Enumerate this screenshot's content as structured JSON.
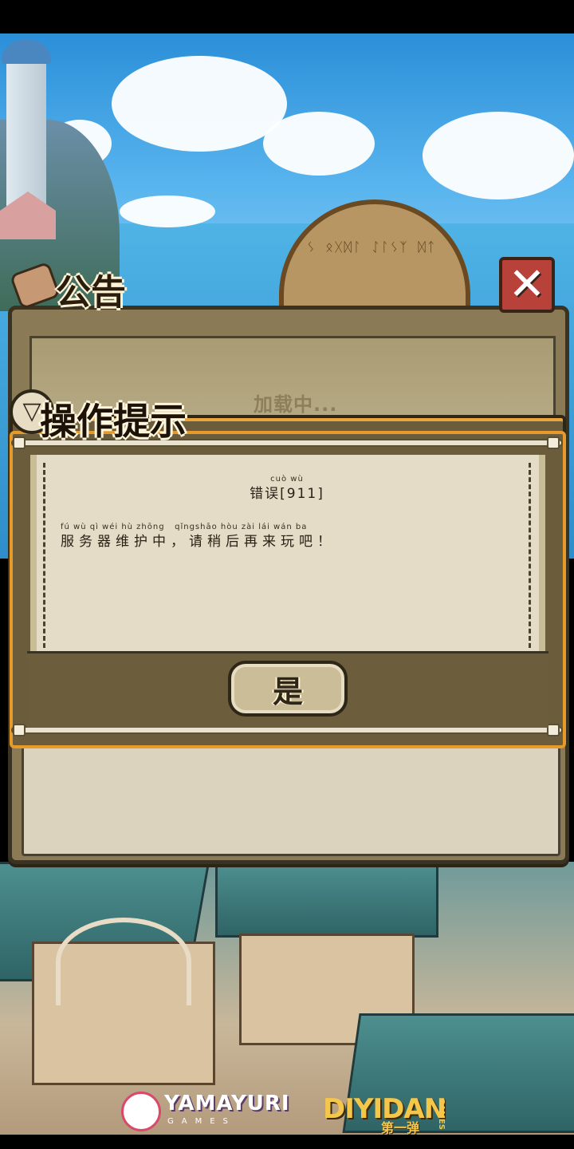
{
  "announcement": {
    "title": "公告",
    "loading_text": "加载中..."
  },
  "dialog": {
    "title": "操作提示",
    "error": {
      "pinyin": "cuò wù",
      "text": "错误[911]"
    },
    "message": {
      "pinyin": "fú wù qì wéi hù zhōng   qǐngshāo hòu zài lái wán ba",
      "text": "服务器维护中，请稍后再来玩吧！"
    },
    "confirm_label": "是"
  },
  "close_icon": "close-icon",
  "footer_brands": {
    "left": "YAMAYURI",
    "left_sub": "GAMES",
    "right": "DIYIDAN",
    "right_sub": "第一弹",
    "right_games": "GAMES"
  },
  "game_logo": {
    "emblem_text": "ᛊ ᛟᚷᛞᛚ ᛇᛚᛊᛉ ᛞᛏ"
  }
}
